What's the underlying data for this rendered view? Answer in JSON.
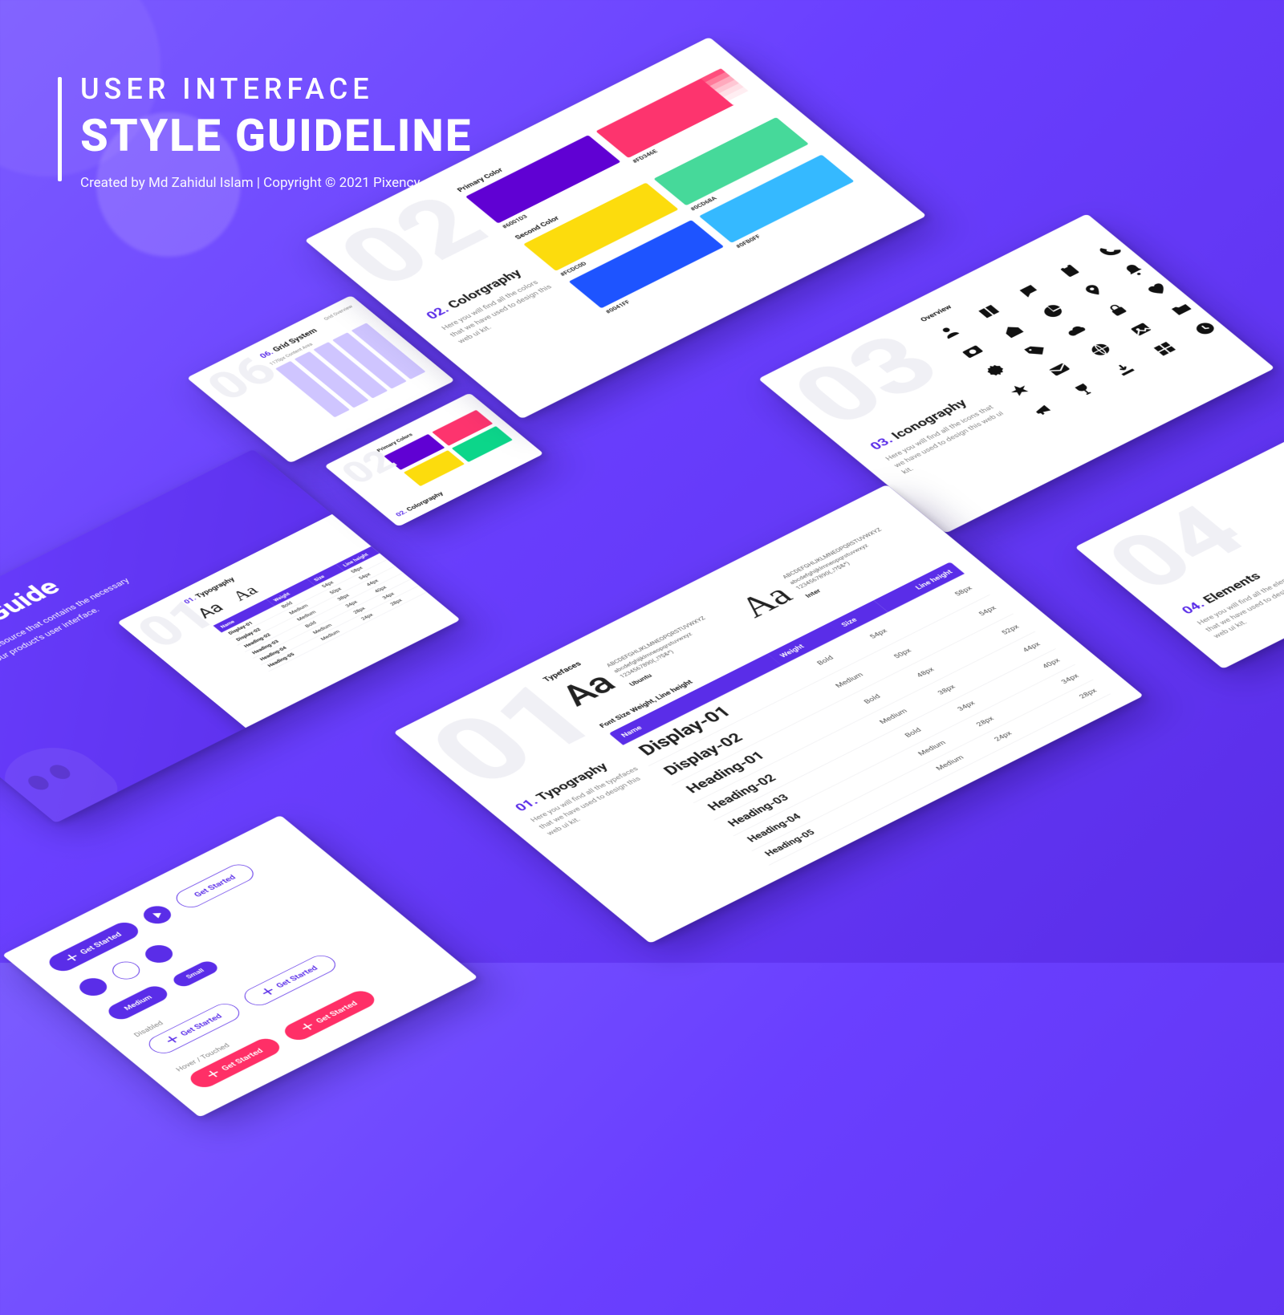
{
  "header": {
    "line1": "USER INTERFACE",
    "line2": "STYLE GUIDELINE",
    "byline": "Created by Md Zahidul Islam   |   Copyright © 2021 Pixency"
  },
  "hero": {
    "title": "UI Style Guide",
    "body": "A UI Style Guide is a resource that contains the necessary details related to your product's user interface.",
    "inset": {
      "num": "01.",
      "title": "Typography"
    }
  },
  "typography": {
    "big_num": "01",
    "num": "01.",
    "title": "Typography",
    "sub": "Here you will find all the typefaces that we have used to design this web ui kit.",
    "typefaces_label": "Typefaces",
    "sample_upper": "ABCDEFGHIJKLMNEOPQRSTUVWXYZ",
    "sample_lower": "abcdefghijklmneopqrstuvwxyz",
    "sample_digits": "1234567890(.,!?$&*)",
    "tf1_name": "Ubuntu",
    "tf2_name": "Inter",
    "table_label": "Font Size Weight, Line height",
    "cols": {
      "c1": "Name",
      "c2": "Weight",
      "c3": "Size",
      "c4": "Line height"
    },
    "rows": [
      {
        "name": "Display-01",
        "weight": "Bold",
        "size": "54px",
        "lh": "58px"
      },
      {
        "name": "Display-02",
        "weight": "Medium",
        "size": "50px",
        "lh": "54px"
      },
      {
        "name": "Heading-01",
        "weight": "Bold",
        "size": "48px",
        "lh": "52px"
      },
      {
        "name": "Heading-02",
        "weight": "Medium",
        "size": "38px",
        "lh": "44px"
      },
      {
        "name": "Heading-03",
        "weight": "Bold",
        "size": "34px",
        "lh": "40px"
      },
      {
        "name": "Heading-04",
        "weight": "Medium",
        "size": "28px",
        "lh": "34px"
      },
      {
        "name": "Heading-05",
        "weight": "Medium",
        "size": "24px",
        "lh": "28px"
      }
    ]
  },
  "color": {
    "big_num": "02",
    "num": "02.",
    "title": "Colorgraphy",
    "sub": "Here you will find all the colors that we have used to design this web ui kit.",
    "primary_label": "Primary Color",
    "second_label": "Second Color",
    "swatches": {
      "primary1": {
        "hex": "#6001D3"
      },
      "primary2": {
        "hex": "#FD346E"
      },
      "sec1": {
        "hex": "#FCDC0D"
      },
      "sec2": {
        "hex": "#0CD68A"
      },
      "sec3": {
        "hex": "#0041FF"
      },
      "sec4": {
        "hex": "#0FB0FF"
      }
    }
  },
  "iconography": {
    "big_num": "03",
    "num": "03.",
    "title": "Iconography",
    "sub": "Here you will find all the icons that we have used to design this web ui kit.",
    "overview": "Overview"
  },
  "elements": {
    "big_num": "04",
    "num": "04.",
    "title": "Elements",
    "sub": "Here you will find all the elements that we have used to design this web ui kit."
  },
  "grid": {
    "big_num": "06",
    "num": "06.",
    "title": "Grid System",
    "overview": "Grid Overview",
    "note": "1170px Content Area"
  },
  "mini_color": {
    "num": "02.",
    "title": "Colorgraphy",
    "label": "Primary Colors"
  },
  "buttons": {
    "label": "Get Started",
    "size_m": "Medium",
    "size_s": "Small",
    "state_hover": "Hover / Touched",
    "state_disabled": "Disabled"
  }
}
